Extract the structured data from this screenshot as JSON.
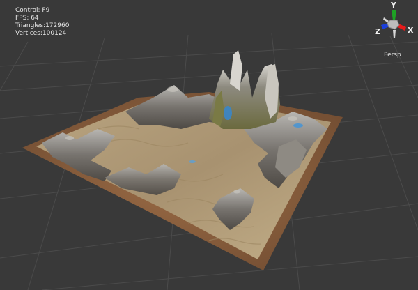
{
  "stats": {
    "control": "Control: F9",
    "fps": "FPS: 64",
    "triangles": "Triangles:172960",
    "vertices": "Vertices:100124"
  },
  "view": {
    "mode": "Persp"
  },
  "gizmo": {
    "y_label": "Y",
    "z_label": "Z",
    "x_label": "X",
    "colors": {
      "x": "#e51b1b",
      "y": "#1ea324",
      "z": "#1b3fd9"
    }
  },
  "colors": {
    "background": "#393939",
    "grid_line": "#4a4a4a",
    "sand": "#b59e77",
    "rock": "#7a7670",
    "dirt": "#8a5e3c",
    "water": "#3a86c8"
  }
}
